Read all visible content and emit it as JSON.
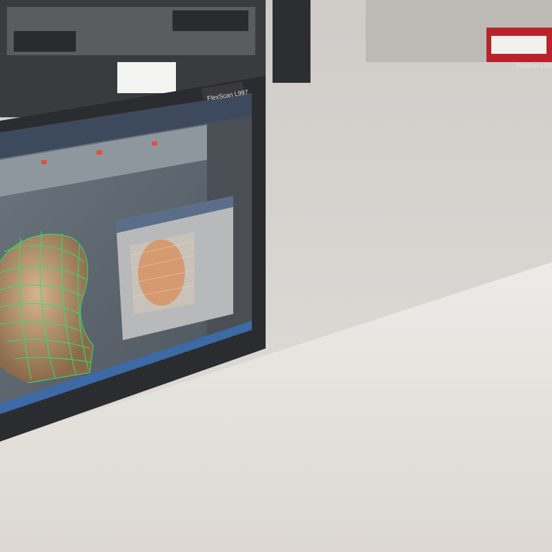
{
  "scene": {
    "monitor_left_badge": "FlexScan L997",
    "monitor_right_badge": "FlexScan L997",
    "keyboard_brand": "hp"
  },
  "colors": {
    "desk": "#e9e6e0",
    "wall": "#d9d7d3",
    "monitor_bezel": "#2b2c2f",
    "left_screen_bg": "#5e6770",
    "wireframe": "#30e06a",
    "right_screen_bg": "#f2f4f7",
    "keyboard_body": "#cfd1d4",
    "keys": "#222326",
    "tablet": "#8e9196"
  }
}
